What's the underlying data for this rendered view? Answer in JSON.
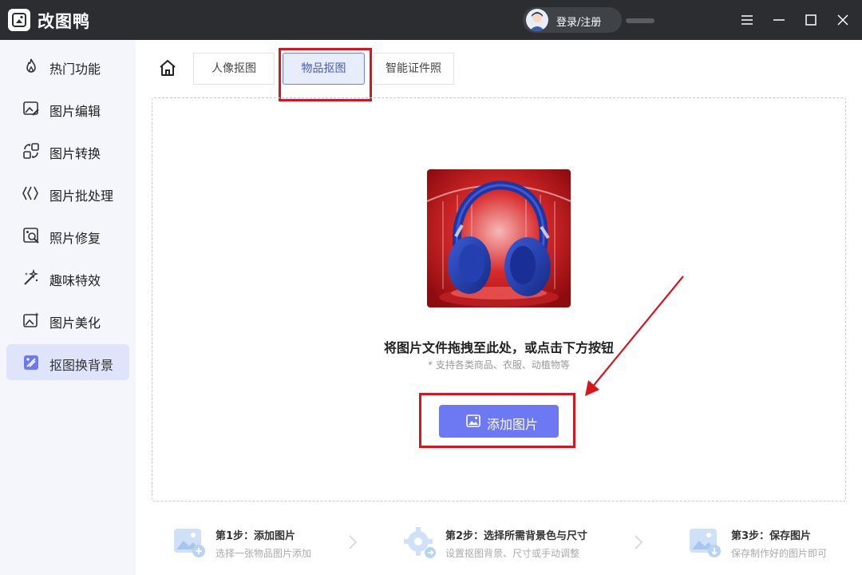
{
  "app": {
    "name": "改图鸭",
    "login": "登录/注册"
  },
  "sidebar": {
    "items": [
      {
        "label": "热门功能",
        "icon": "flame-icon"
      },
      {
        "label": "图片编辑",
        "icon": "image-edit-icon"
      },
      {
        "label": "图片转换",
        "icon": "convert-icon"
      },
      {
        "label": "图片批处理",
        "icon": "batch-icon"
      },
      {
        "label": "照片修复",
        "icon": "photo-repair-icon"
      },
      {
        "label": "趣味特效",
        "icon": "magic-wand-icon"
      },
      {
        "label": "图片美化",
        "icon": "beautify-icon"
      },
      {
        "label": "抠图换背景",
        "icon": "cutout-icon",
        "active": true
      }
    ]
  },
  "tabs": [
    {
      "label": "人像抠图"
    },
    {
      "label": "物品抠图",
      "active": true
    },
    {
      "label": "智能证件照"
    }
  ],
  "dropzone": {
    "title": "将图片文件拖拽至此处，或点击下方按钮",
    "hint": "* 支持各类商品、衣服、动植物等",
    "button": "添加图片"
  },
  "steps": [
    {
      "title": "第1步：添加图片",
      "desc": "选择一张物品图片添加"
    },
    {
      "title": "第2步：选择所需背景色与尺寸",
      "desc": "设置抠图背景、尺寸或手动调整"
    },
    {
      "title": "第3步：保存图片",
      "desc": "保存制作好的图片即可"
    }
  ],
  "colors": {
    "accent": "#6d79f3",
    "highlight": "#d8141c",
    "titlebar": "#2b2d31",
    "sidebar_active": "#dfe4fb"
  }
}
